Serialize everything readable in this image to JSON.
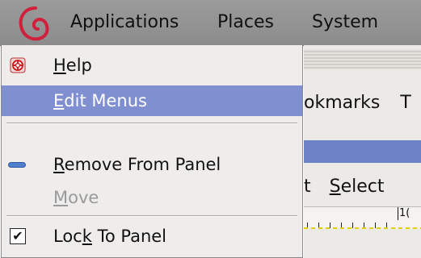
{
  "panel": {
    "items": [
      {
        "label": "Applications"
      },
      {
        "label": "Places"
      },
      {
        "label": "System"
      }
    ]
  },
  "background_window": {
    "menu1_visible_text": "okmarks",
    "menu1_trailing": "T",
    "menu2_visible_text_1": "t",
    "menu2_visible_text_2": "Select",
    "ruler_label": "1("
  },
  "context_menu": {
    "items": [
      {
        "pre": "",
        "mnemonic": "H",
        "post": "elp",
        "icon": "help-lifebuoy-icon",
        "enabled": true
      },
      {
        "pre": "",
        "mnemonic": "E",
        "post": "dit Menus",
        "icon": "none",
        "enabled": true,
        "highlighted": true
      },
      {
        "pre": "",
        "mnemonic": "R",
        "post": "emove From Panel",
        "icon": "remove-bar-icon",
        "enabled": true
      },
      {
        "pre": "",
        "mnemonic": "M",
        "post": "ove",
        "icon": "none",
        "enabled": false
      },
      {
        "pre": "Loc",
        "mnemonic": "k",
        "post": " To Panel",
        "icon": "checkbox-checked-icon",
        "enabled": true,
        "checked": true
      }
    ],
    "checkmark": "✔"
  },
  "colors": {
    "highlight": "#7f8fd0",
    "panel_bg": "#9b9b9b",
    "menu_bg": "#eeedeb",
    "disabled_text": "#9a9a9a",
    "title_bar": "#6c83c8",
    "logo_red": "#d0203b"
  }
}
